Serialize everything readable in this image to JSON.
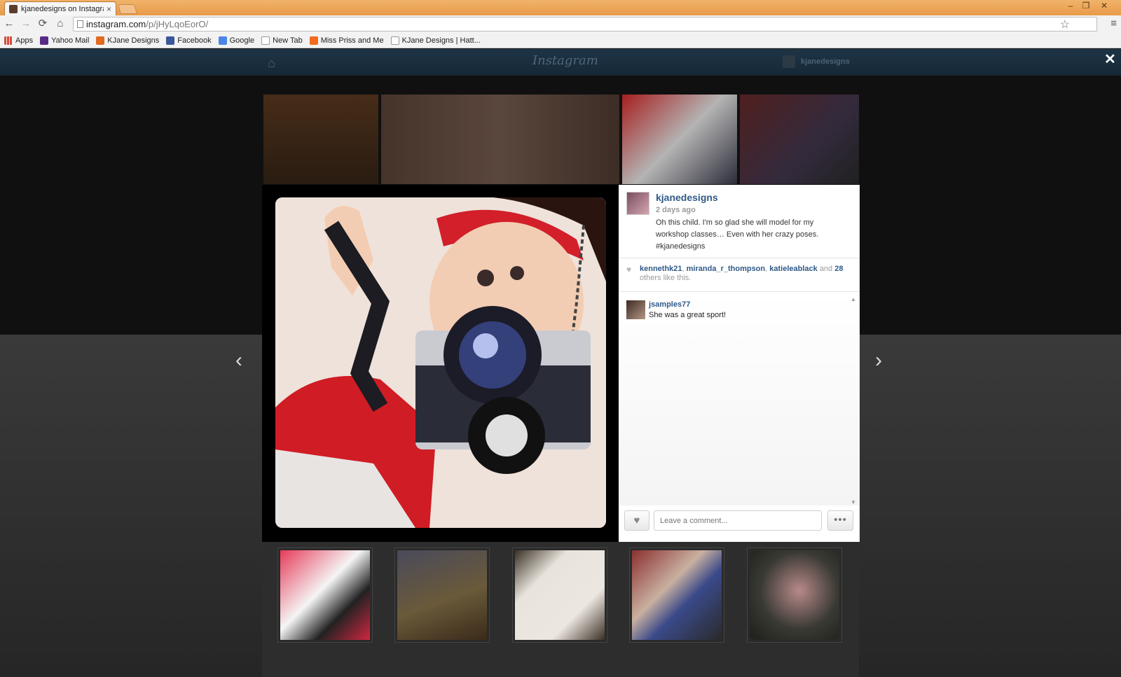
{
  "browser": {
    "tab_title": "kjanedesigns on Instagram",
    "tab_close": "×",
    "url_host": "instagram.com",
    "url_path": "/p/jHyLqoEorO/",
    "window_controls": [
      "–",
      "❐",
      "✕"
    ],
    "nav": {
      "back": "←",
      "forward": "→",
      "reload": "⟳",
      "home": "⌂"
    },
    "star": "☆",
    "menu": "≡",
    "bookmarks": [
      {
        "label": "Apps",
        "color": "#d64b3c"
      },
      {
        "label": "Yahoo Mail",
        "color": "#5b2a86"
      },
      {
        "label": "KJane Designs",
        "color": "#e06a1f"
      },
      {
        "label": "Facebook",
        "color": "#3b5998"
      },
      {
        "label": "Google",
        "color": "#4a86e8"
      },
      {
        "label": "New Tab",
        "color": "#ffffff"
      },
      {
        "label": "Miss Priss and Me",
        "color": "#f26b1d"
      },
      {
        "label": "KJane Designs | Hatt...",
        "color": "#ffffff"
      }
    ]
  },
  "header": {
    "logo": "Instagram",
    "home_icon": "⌂",
    "username": "kjanedesigns",
    "close": "✕"
  },
  "navigation": {
    "prev": "‹",
    "next": "›"
  },
  "post": {
    "author": "kjanedesigns",
    "time": "2 days ago",
    "caption": "Oh this child. I'm so glad she will model for my workshop classes… Even with her crazy poses. #kjanedesigns",
    "likes": {
      "users": [
        "kennethk21",
        "miranda_r_thompson",
        "katieleablack"
      ],
      "others_count": "28",
      "and_text": "and",
      "suffix": "others like this."
    },
    "comments": [
      {
        "user": "jsamples77",
        "text": "She was a great sport!"
      }
    ],
    "comment_placeholder": "Leave a comment...",
    "like_icon": "♥",
    "more_icon": "•••"
  },
  "colors": {
    "link": "#2f5a87",
    "header_bg": "#1e3446",
    "backdrop": "#101010"
  }
}
